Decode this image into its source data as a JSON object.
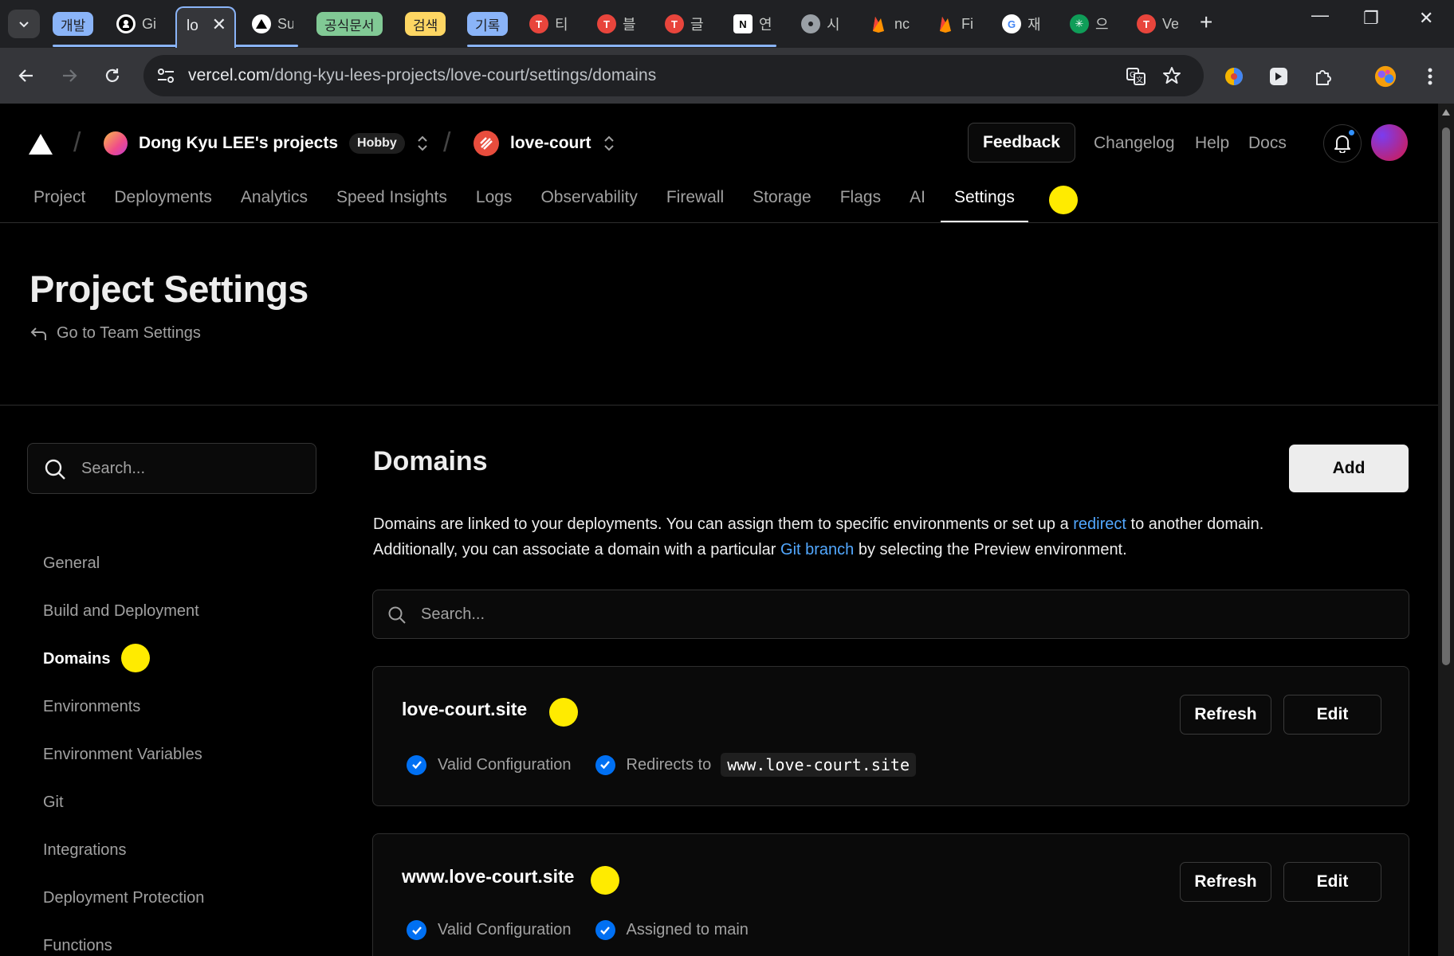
{
  "browser": {
    "tab_groups": [
      {
        "label": "개발",
        "color": "#8ab4f8"
      },
      {
        "label": "공식문서",
        "color": "#81c995"
      },
      {
        "label": "검색",
        "color": "#fdd663"
      },
      {
        "label": "기록",
        "color": "#8ab4f8"
      }
    ],
    "tabs": [
      {
        "title": "Gi",
        "icon": "github-icon",
        "color": "#ffffff"
      },
      {
        "title": "Su",
        "icon": "vercel-icon",
        "color": "#000000"
      },
      {
        "title": "티",
        "icon": "hankyung-icon",
        "color": "#e8453c"
      },
      {
        "title": "블",
        "icon": "hankyung-icon",
        "color": "#e8453c"
      },
      {
        "title": "글",
        "icon": "hankyung-icon",
        "color": "#e8453c"
      },
      {
        "title": "연",
        "icon": "notion-icon",
        "color": "#ffffff"
      },
      {
        "title": "시",
        "icon": "chrome-icon",
        "color": "#9aa0a6"
      },
      {
        "title": "nc",
        "icon": "firebase-icon",
        "color": "#ff9100"
      },
      {
        "title": "Fi",
        "icon": "firebase-icon",
        "color": "#ff9100"
      },
      {
        "title": "재",
        "icon": "google-icon",
        "color": "#ffffff"
      },
      {
        "title": "으",
        "icon": "app-icon",
        "color": "#0f9d58"
      },
      {
        "title": "Ve",
        "icon": "hankyung-icon",
        "color": "#e8453c"
      }
    ],
    "active_tab_title": "lo",
    "url_domain": "vercel.com",
    "url_path": "/dong-kyu-lees-projects/love-court/settings/domains"
  },
  "topnav": {
    "team_name": "Dong Kyu LEE's projects",
    "plan_badge": "Hobby",
    "project_name": "love-court",
    "feedback_label": "Feedback",
    "links": [
      "Changelog",
      "Help",
      "Docs"
    ]
  },
  "subnav": {
    "items": [
      "Project",
      "Deployments",
      "Analytics",
      "Speed Insights",
      "Logs",
      "Observability",
      "Firewall",
      "Storage",
      "Flags",
      "AI",
      "Settings"
    ],
    "active": "Settings"
  },
  "header": {
    "title": "Project Settings",
    "team_settings_link": "Go to Team Settings"
  },
  "sidebar": {
    "search_placeholder": "Search...",
    "items": [
      "General",
      "Build and Deployment",
      "Domains",
      "Environments",
      "Environment Variables",
      "Git",
      "Integrations",
      "Deployment Protection",
      "Functions"
    ],
    "active": "Domains"
  },
  "domains": {
    "title": "Domains",
    "add_label": "Add",
    "desc_1": "Domains are linked to your deployments. You can assign them to specific environments or set up a ",
    "desc_link_1": "redirect",
    "desc_2": " to another domain. Additionally, you can associate a domain with a particular ",
    "desc_link_2": "Git branch",
    "desc_3": " by selecting the Preview environment.",
    "search_placeholder": "Search...",
    "list": [
      {
        "name": "love-court.site",
        "status_1": "Valid Configuration",
        "status_2": "Redirects to",
        "status_2_code": "www.love-court.site",
        "refresh_label": "Refresh",
        "edit_label": "Edit"
      },
      {
        "name": "www.love-court.site",
        "status_1": "Valid Configuration",
        "status_2": "Assigned to main",
        "status_2_code": "",
        "refresh_label": "Refresh",
        "edit_label": "Edit"
      }
    ]
  },
  "colors": {
    "accent_link": "#52a8ff",
    "check_blue": "#0070f3",
    "marker_yellow": "#ffeb00"
  }
}
